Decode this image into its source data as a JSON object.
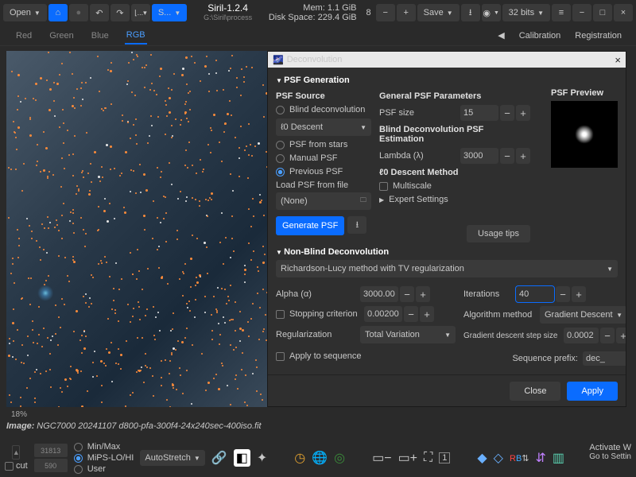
{
  "header": {
    "open": "Open",
    "script_btn": "S...",
    "title": "Siril-1.2.4",
    "subtitle": "G:\\Siril\\process",
    "mem": "Mem: 1.1 GiB",
    "disk": "Disk Space: 229.4 GiB",
    "zoom_value": "8",
    "save": "Save",
    "bits": "32 bits"
  },
  "tabs": {
    "red": "Red",
    "green": "Green",
    "blue": "Blue",
    "rgb": "RGB",
    "calibration": "Calibration",
    "registration": "Registration"
  },
  "canvas": {
    "percent": "18%",
    "image_label": "Image:",
    "filename": "NGC7000 20241107 d800-pfa-300f4-24x240sec-400iso.fit"
  },
  "dialog": {
    "title": "Deconvolution",
    "psf_generation": "PSF Generation",
    "psf_source": "PSF Source",
    "blind": "Blind deconvolution",
    "descent_sel": "ℓ0 Descent",
    "from_stars": "PSF from stars",
    "manual": "Manual PSF",
    "previous": "Previous PSF",
    "load_file": "Load PSF from file",
    "none": "(None)",
    "generate": "Generate PSF",
    "general_params": "General PSF Parameters",
    "psf_size_lbl": "PSF size",
    "psf_size": "15",
    "blind_est": "Blind Deconvolution PSF Estimation",
    "lambda_lbl": "Lambda (λ)",
    "lambda": "3000",
    "l0_method": "ℓ0 Descent Method",
    "multiscale": "Multiscale",
    "expert": "Expert Settings",
    "psf_preview": "PSF Preview",
    "usage": "Usage tips",
    "nonblind": "Non-Blind Deconvolution",
    "method": "Richardson-Lucy method with TV regularization",
    "alpha_lbl": "Alpha (α)",
    "alpha": "3000.00",
    "iter_lbl": "Iterations",
    "iter": "40",
    "stop_lbl": "Stopping criterion",
    "stop": "0.00200",
    "algo_lbl": "Algorithm method",
    "algo": "Gradient Descent",
    "reg_lbl": "Regularization",
    "reg": "Total Variation",
    "step_lbl": "Gradient descent step size",
    "step": "0.0002",
    "apply_seq": "Apply to sequence",
    "seq_prefix_lbl": "Sequence prefix:",
    "seq_prefix": "dec_",
    "close": "Close",
    "apply": "Apply"
  },
  "bottom": {
    "cut": "cut",
    "val1": "31813",
    "val2": "590",
    "minmax": "Min/Max",
    "mips": "MiPS-LO/HI",
    "user": "User",
    "autostretch": "AutoStretch"
  },
  "watermark": {
    "l1": "Activate W",
    "l2": "Go to Settin"
  }
}
